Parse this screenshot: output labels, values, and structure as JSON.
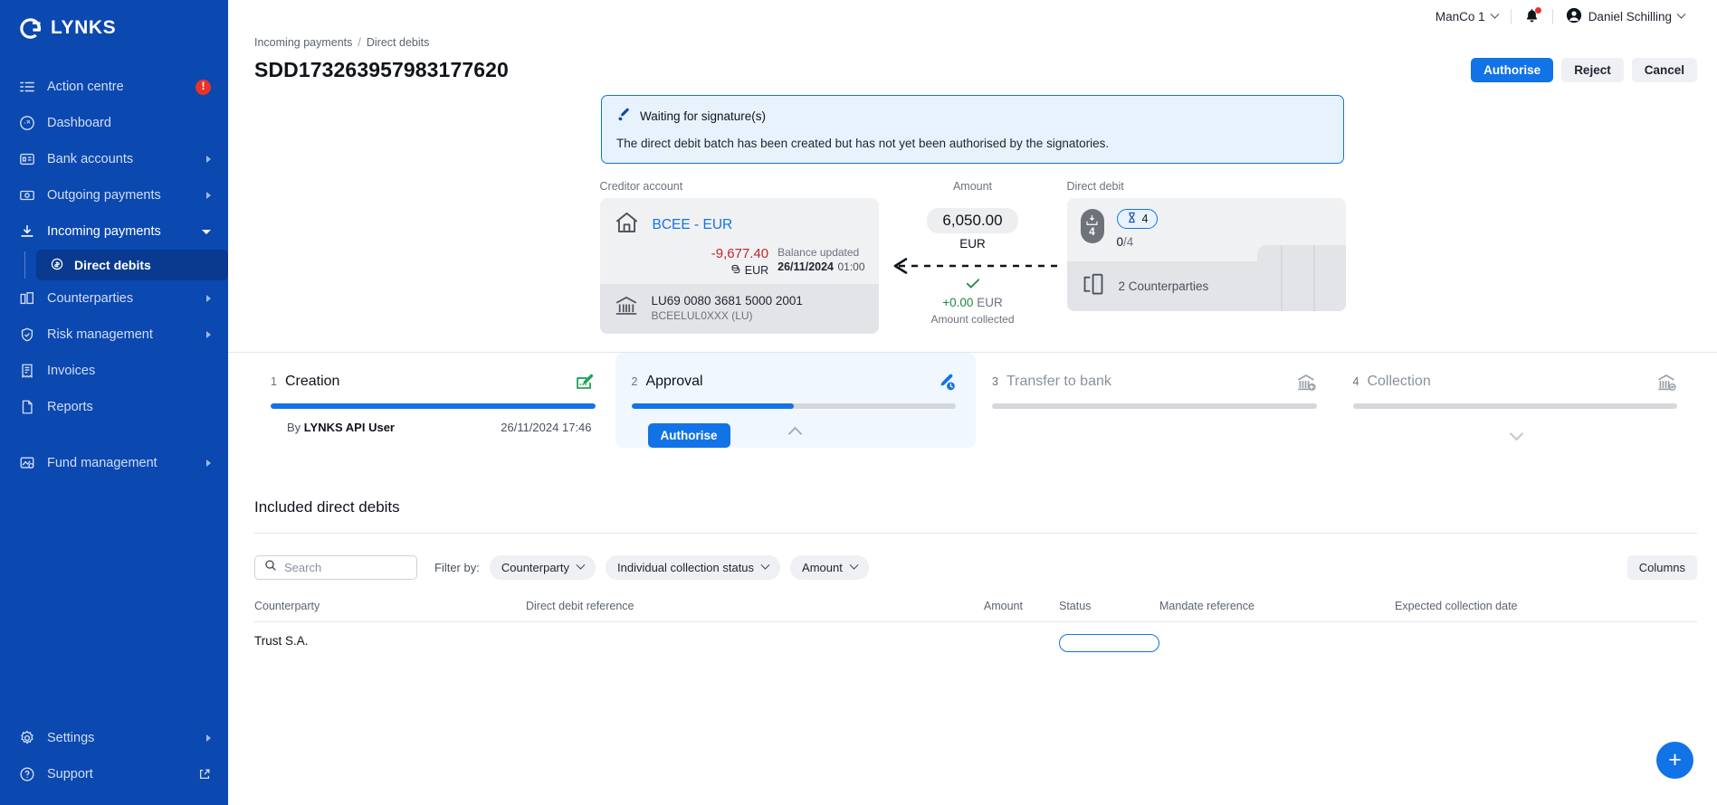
{
  "brand": {
    "name": "LYNKS",
    "logo_icon": "lynks-logo-icon"
  },
  "sidebar": {
    "items": [
      {
        "label": "Action centre",
        "icon": "action-centre-icon",
        "badge": "!"
      },
      {
        "label": "Dashboard",
        "icon": "dashboard-icon"
      },
      {
        "label": "Bank accounts",
        "icon": "bank-accounts-icon",
        "expandable": true
      },
      {
        "label": "Outgoing payments",
        "icon": "outgoing-payments-icon",
        "expandable": true
      },
      {
        "label": "Incoming payments",
        "icon": "incoming-payments-icon",
        "expanded": true
      },
      {
        "label": "Counterparties",
        "icon": "counterparties-icon",
        "expandable": true
      },
      {
        "label": "Risk management",
        "icon": "risk-management-icon",
        "expandable": true
      },
      {
        "label": "Invoices",
        "icon": "invoices-icon"
      },
      {
        "label": "Reports",
        "icon": "reports-icon"
      },
      {
        "label": "Fund management",
        "icon": "fund-management-icon",
        "expandable": true
      }
    ],
    "subitems": [
      {
        "label": "Direct debits",
        "icon": "direct-debits-icon",
        "selected": true
      }
    ],
    "bottom_items": [
      {
        "label": "Settings",
        "icon": "settings-gear-icon",
        "expandable": true
      },
      {
        "label": "Support",
        "icon": "support-help-icon",
        "external": true
      }
    ]
  },
  "topbar": {
    "org": "ManCo 1",
    "user": "Daniel Schilling",
    "bell_icon": "notification-bell-icon",
    "avatar_icon": "user-avatar-icon"
  },
  "breadcrumb": {
    "parent": "Incoming payments",
    "separator": "/",
    "current": "Direct debits"
  },
  "header": {
    "title": "SDD173263957983177620",
    "authorise_label": "Authorise",
    "reject_label": "Reject",
    "cancel_label": "Cancel"
  },
  "banner": {
    "icon": "signature-pen-icon",
    "title": "Waiting for signature(s)",
    "text": "The direct debit batch has been created but has not yet been authorised by the signatories."
  },
  "summary": {
    "creditor": {
      "section_label": "Creditor account",
      "home_icon": "home-icon",
      "account_name": "BCEE - EUR",
      "balance_amount": "-9,677.40",
      "balance_currency": "EUR",
      "coins_icon": "coins-icon",
      "balance_updated_label": "Balance updated",
      "balance_updated_date": "26/11/2024",
      "balance_updated_time": "01:00",
      "bank_icon": "bank-building-icon",
      "iban": "LU69 0080 3681 5000 2001",
      "bic": "BCEELUL0XXX (LU)"
    },
    "amount": {
      "section_label": "Amount",
      "value": "6,050.00",
      "currency": "EUR",
      "arrow_icon": "arrow-left-dashed-icon",
      "check_icon": "check-icon",
      "collected_value": "+0.00",
      "collected_currency": "EUR",
      "collected_label": "Amount collected"
    },
    "direct_debit": {
      "section_label": "Direct debit",
      "avatar_icon": "direct-debit-inbox-icon",
      "avatar_count": "4",
      "status_icon": "hourglass-icon",
      "status_count": "4",
      "progress_done": "0",
      "progress_sep": "/",
      "progress_total": "4",
      "counterparties_icon": "counterparties-building-icon",
      "counterparties_text": "2 Counterparties"
    }
  },
  "steps": [
    {
      "num": "1",
      "label": "Creation",
      "icon": "creation-edit-icon",
      "progress": 100,
      "state": "done",
      "by_prefix": "By",
      "by_name": "LYNKS API User",
      "date": "26/11/2024 17:46"
    },
    {
      "num": "2",
      "label": "Approval",
      "icon": "approval-pen-clock-icon",
      "progress": 50,
      "state": "active",
      "button_label": "Authorise",
      "toggle_icon": "chevron-up-icon"
    },
    {
      "num": "3",
      "label": "Transfer to bank",
      "icon": "transfer-to-bank-icon",
      "progress": 0,
      "state": "future"
    },
    {
      "num": "4",
      "label": "Collection",
      "icon": "collection-bank-icon",
      "progress": 0,
      "state": "future",
      "toggle_icon": "chevron-down-icon"
    }
  ],
  "table_section": {
    "title": "Included direct debits",
    "search_placeholder": "Search",
    "search_value": "",
    "search_icon": "search-icon",
    "filter_label": "Filter by:",
    "filters": [
      {
        "label": "Counterparty"
      },
      {
        "label": "Individual collection status"
      },
      {
        "label": "Amount"
      }
    ],
    "columns_label": "Columns",
    "headers": {
      "counterparty": "Counterparty",
      "reference": "Direct debit reference",
      "amount": "Amount",
      "status": "Status",
      "mandate": "Mandate reference",
      "expected": "Expected collection date"
    },
    "rows": [
      {
        "counterparty": "Trust S.A.",
        "reference": "",
        "amount": "",
        "status": "",
        "mandate": "",
        "expected": ""
      }
    ]
  },
  "fab": {
    "icon": "plus-icon",
    "label": "+"
  },
  "colors": {
    "sidebar": "#0B48B0",
    "sidebar_selected": "#093A8F",
    "primary": "#1273E6",
    "danger": "#C0272D",
    "success": "#1C8A3C",
    "badge": "#E8332A"
  }
}
